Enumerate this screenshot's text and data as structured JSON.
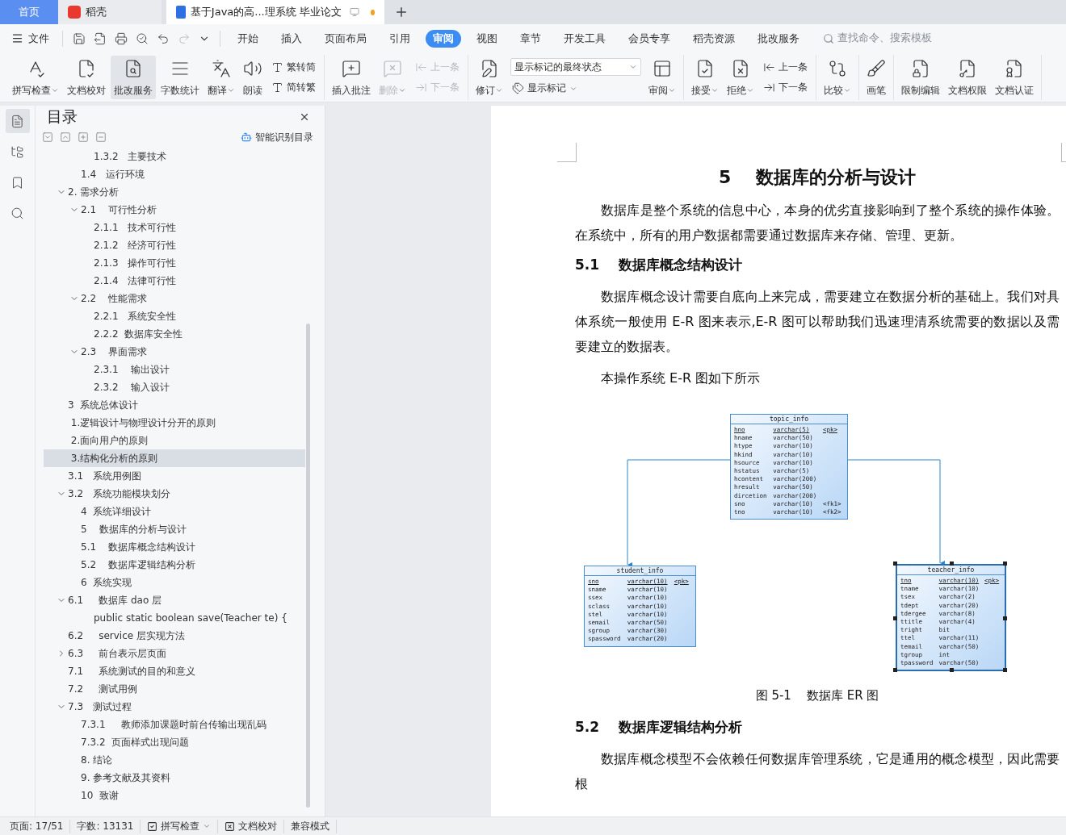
{
  "title_tabs": [
    {
      "label": "首页",
      "kind": "home",
      "selected": false
    },
    {
      "label": "稻壳",
      "kind": "app",
      "selected": false
    },
    {
      "label": "基于Java的高...理系统 毕业论文",
      "kind": "doc",
      "selected": true,
      "modified": true
    }
  ],
  "menu": {
    "file_label": "文件",
    "tabs": [
      {
        "label": "开始",
        "selected": false
      },
      {
        "label": "插入",
        "selected": false
      },
      {
        "label": "页面布局",
        "selected": false
      },
      {
        "label": "引用",
        "selected": false
      },
      {
        "label": "审阅",
        "selected": true
      },
      {
        "label": "视图",
        "selected": false
      },
      {
        "label": "章节",
        "selected": false
      },
      {
        "label": "开发工具",
        "selected": false
      },
      {
        "label": "会员专享",
        "selected": false
      },
      {
        "label": "稻壳资源",
        "selected": false
      },
      {
        "label": "批改服务",
        "selected": false
      }
    ],
    "search": {
      "placeholder": "查找命令、搜索模板"
    }
  },
  "ribbon": [
    {
      "items": [
        {
          "kind": "large",
          "label": "拼写检查",
          "caret": true,
          "disabled": false,
          "pressed": false
        },
        {
          "kind": "large",
          "label": "文档校对",
          "caret": false,
          "disabled": false,
          "pressed": false
        },
        {
          "kind": "large",
          "label": "批改服务",
          "caret": false,
          "disabled": false,
          "pressed": true
        },
        {
          "kind": "large",
          "label": "字数统计",
          "caret": false,
          "disabled": false,
          "pressed": false
        },
        {
          "kind": "large",
          "label": "翻译",
          "caret": true,
          "disabled": false,
          "pressed": false
        },
        {
          "kind": "large",
          "label": "朗读",
          "caret": false,
          "disabled": false,
          "pressed": false
        },
        {
          "kind": "stack",
          "items": [
            {
              "label": "繁转简",
              "caret": false,
              "disabled": false
            },
            {
              "label": "简转繁",
              "caret": false,
              "disabled": false
            }
          ]
        }
      ]
    },
    {
      "items": [
        {
          "kind": "large",
          "label": "插入批注",
          "caret": false,
          "disabled": false,
          "pressed": false
        },
        {
          "kind": "large",
          "label": "删除",
          "caret": true,
          "disabled": true,
          "pressed": false
        },
        {
          "kind": "stack",
          "items": [
            {
              "label": "上一条",
              "caret": false,
              "disabled": true
            },
            {
              "label": "下一条",
              "caret": false,
              "disabled": true
            }
          ]
        }
      ]
    },
    {
      "items": [
        {
          "kind": "large",
          "label": "修订",
          "caret": true,
          "disabled": false,
          "pressed": false
        },
        {
          "kind": "select",
          "value": "显示标记的最终状态",
          "items": [
            {
              "label": "显示标记",
              "caret": true,
              "disabled": false
            }
          ]
        },
        {
          "kind": "large",
          "label": "审阅",
          "caret": true,
          "disabled": false,
          "pressed": false
        }
      ]
    },
    {
      "items": [
        {
          "kind": "large",
          "label": "接受",
          "caret": true,
          "disabled": false,
          "pressed": false
        },
        {
          "kind": "large",
          "label": "拒绝",
          "caret": true,
          "disabled": false,
          "pressed": false
        },
        {
          "kind": "stack",
          "items": [
            {
              "label": "上一条",
              "caret": false,
              "disabled": false
            },
            {
              "label": "下一条",
              "caret": false,
              "disabled": false
            }
          ]
        }
      ]
    },
    {
      "items": [
        {
          "kind": "large",
          "label": "比较",
          "caret": true,
          "disabled": false,
          "pressed": false
        }
      ]
    },
    {
      "items": [
        {
          "kind": "large",
          "label": "画笔",
          "caret": false,
          "disabled": false,
          "pressed": false
        }
      ]
    },
    {
      "items": [
        {
          "kind": "large",
          "label": "限制编辑",
          "caret": false,
          "disabled": false,
          "pressed": false
        },
        {
          "kind": "large",
          "label": "文档权限",
          "caret": false,
          "disabled": false,
          "pressed": false
        },
        {
          "kind": "large",
          "label": "文档认证",
          "caret": false,
          "disabled": false,
          "pressed": false
        }
      ]
    }
  ],
  "side_strip": [
    {
      "selected": true
    },
    {
      "selected": false
    },
    {
      "selected": false
    },
    {
      "selected": false
    }
  ],
  "toc": {
    "title": "目录",
    "smart_label": "智能识别目录",
    "items": [
      {
        "children": [
          {
            "children": [
              {
                "label": "1.3.2   主要技术",
                "selected": false
              }
            ]
          },
          {
            "label": "1.4   运行环境",
            "selected": false
          }
        ]
      },
      {
        "label": "2. 需求分析",
        "selected": false,
        "expanded": true,
        "children": [
          {
            "label": "2.1    可行性分析",
            "selected": false,
            "expanded": true,
            "children": [
              {
                "label": "2.1.1   技术可行性",
                "selected": false
              },
              {
                "label": "2.1.2   经济可行性",
                "selected": false
              },
              {
                "label": "2.1.3   操作可行性",
                "selected": false
              },
              {
                "label": "2.1.4   法律可行性",
                "selected": false
              }
            ]
          },
          {
            "label": "2.2    性能需求",
            "selected": false,
            "expanded": true,
            "children": [
              {
                "label": "2.2.1   系统安全性",
                "selected": false
              },
              {
                "label": "2.2.2  数据库安全性",
                "selected": false
              }
            ]
          },
          {
            "label": "2.3    界面需求",
            "selected": false,
            "expanded": true,
            "children": [
              {
                "label": "2.3.1    输出设计",
                "selected": false
              },
              {
                "label": "2.3.2    输入设计",
                "selected": false
              }
            ]
          }
        ]
      },
      {
        "label": "3  系统总体设计",
        "selected": false
      },
      {
        "label": " 1.逻辑设计与物理设计分开的原则",
        "selected": false
      },
      {
        "label": " 2.面向用户的原则",
        "selected": false
      },
      {
        "label": " 3.结构化分析的原则",
        "selected": true
      },
      {
        "label": "3.1   系统用例图",
        "selected": false
      },
      {
        "label": "3.2   系统功能模块划分",
        "selected": false,
        "expanded": true,
        "children": [
          {
            "label": "4  系统详细设计",
            "selected": false
          },
          {
            "label": "5    数据库的分析与设计",
            "selected": false
          },
          {
            "label": "5.1    数据库概念结构设计",
            "selected": false
          },
          {
            "label": "5.2    数据库逻辑结构分析",
            "selected": false
          },
          {
            "label": "6  系统实现",
            "selected": false
          }
        ]
      },
      {
        "label": "6.1     数据库 dao 层",
        "selected": false,
        "expanded": true,
        "children": [
          {
            "children": [
              {
                "label": "public static boolean save(Teacher te) {",
                "selected": false
              }
            ]
          }
        ]
      },
      {
        "label": "6.2     service 层实现方法",
        "selected": false
      },
      {
        "label": "6.3     前台表示层页面",
        "selected": false,
        "expanded": false
      },
      {
        "label": "7.1     系统测试的目的和意义",
        "selected": false
      },
      {
        "label": "7.2     测试用例",
        "selected": false
      },
      {
        "label": "7.3   测试过程",
        "selected": false,
        "expanded": true,
        "children": [
          {
            "label": "7.3.1     教师添加课题时前台传输出现乱码",
            "selected": false
          },
          {
            "label": "7.3.2  页面样式出现问题",
            "selected": false
          },
          {
            "label": "8. 结论",
            "selected": false
          },
          {
            "label": "9. 参考文献及其资料",
            "selected": false
          },
          {
            "label": "10  致谢",
            "selected": false
          }
        ]
      }
    ]
  },
  "document": {
    "blocks": [
      {
        "kind": "h1",
        "text": "5    数据库的分析与设计"
      },
      {
        "kind": "p",
        "text": "数据库是整个系统的信息中心，本身的优劣直接影响到了整个系统的操作体验。在系统中，所有的用户数据都需要通过数据库来存储、管理、更新。"
      },
      {
        "kind": "h2",
        "text": "5.1    数据库概念结构设计"
      },
      {
        "kind": "p",
        "text": "数据库概念设计需要自底向上来完成，需要建立在数据分析的基础上。我们对具体系统一般使用 E-R 图来表示,E-R 图可以帮助我们迅速理清系统需要的数据以及需要建立的数据表。"
      },
      {
        "kind": "p",
        "text": "本操作系统 E-R 图如下所示"
      },
      {
        "kind": "er",
        "tables": [
          {
            "name": "topic_info",
            "selected": false,
            "rows": [
              {
                "column": "hno",
                "type": "varchar(5)",
                "key": "<pk>"
              },
              {
                "column": "hname",
                "type": "varchar(50)"
              },
              {
                "column": "htype",
                "type": "varchar(10)"
              },
              {
                "column": "hkind",
                "type": "varchar(10)"
              },
              {
                "column": "hsource",
                "type": "varchar(10)"
              },
              {
                "column": "hstatus",
                "type": "varchar(5)"
              },
              {
                "column": "hcontent",
                "type": "varchar(200)"
              },
              {
                "column": "hresult",
                "type": "varchar(50)"
              },
              {
                "column": "dircetion",
                "type": "varchar(200)"
              },
              {
                "column": "sno",
                "type": "varchar(10)",
                "key": "<fk1>"
              },
              {
                "column": "tno",
                "type": "varchar(10)",
                "key": "<fk2>"
              }
            ]
          },
          {
            "name": "student_info",
            "selected": false,
            "rows": [
              {
                "column": "sno",
                "type": "varchar(10)",
                "key": "<pk>"
              },
              {
                "column": "sname",
                "type": "varchar(10)"
              },
              {
                "column": "ssex",
                "type": "varchar(10)"
              },
              {
                "column": "sclass",
                "type": "varchar(10)"
              },
              {
                "column": "stel",
                "type": "varchar(10)"
              },
              {
                "column": "semail",
                "type": "varchar(50)"
              },
              {
                "column": "sgroup",
                "type": "varchar(30)"
              },
              {
                "column": "spassword",
                "type": "varchar(20)"
              }
            ]
          },
          {
            "name": "teacher_info",
            "selected": true,
            "rows": [
              {
                "column": "tno",
                "type": "varchar(10)",
                "key": "<pk>"
              },
              {
                "column": "tname",
                "type": "varchar(10)"
              },
              {
                "column": "tsex",
                "type": "varchar(2)"
              },
              {
                "column": "tdept",
                "type": "varchar(20)"
              },
              {
                "column": "tdergee",
                "type": "varchar(8)"
              },
              {
                "column": "ttitle",
                "type": "varchar(4)"
              },
              {
                "column": "tright",
                "type": "bit"
              },
              {
                "column": "ttel",
                "type": "varchar(11)"
              },
              {
                "column": "temail",
                "type": "varchar(50)"
              },
              {
                "column": "tgroup",
                "type": "int"
              },
              {
                "column": "tpassword",
                "type": "varchar(50)"
              }
            ]
          }
        ]
      },
      {
        "kind": "caption",
        "text": "图 5-1    数据库 ER 图"
      },
      {
        "kind": "h2",
        "text": "5.2    数据库逻辑结构分析"
      },
      {
        "kind": "p",
        "text": "数据库概念模型不会依赖任何数据库管理系统，它是通用的概念模型，因此需要根"
      }
    ]
  },
  "status_bar": [
    {
      "kind": "text",
      "label": "页面: 17/51"
    },
    {
      "kind": "text",
      "label": "字数: 13131"
    },
    {
      "kind": "check",
      "label": "拼写检查",
      "caret": true
    },
    {
      "kind": "check",
      "label": "文档校对",
      "caret": false
    },
    {
      "kind": "text",
      "label": "兼容模式"
    }
  ]
}
